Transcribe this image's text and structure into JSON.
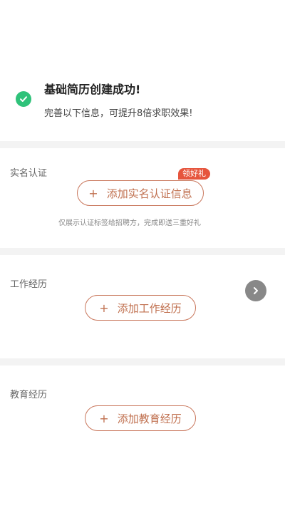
{
  "success": {
    "title": "基础简历创建成功!",
    "subtitle": "完善以下信息，可提升8倍求职效果!"
  },
  "sections": [
    {
      "label": "实名认证",
      "button": "添加实名认证信息",
      "badge": "领好礼",
      "hint": "仅展示认证标签给招聘方，完成即送三重好礼"
    },
    {
      "label": "工作经历",
      "button": "添加工作经历"
    },
    {
      "label": "教育经历",
      "button": "添加教育经历"
    }
  ],
  "colors": {
    "accent": "#c0704f",
    "success": "#2fc27a",
    "badge": "#e6553d"
  },
  "icons": {
    "success": "check-circle-icon",
    "add": "plus-icon",
    "next": "chevron-right-icon"
  }
}
